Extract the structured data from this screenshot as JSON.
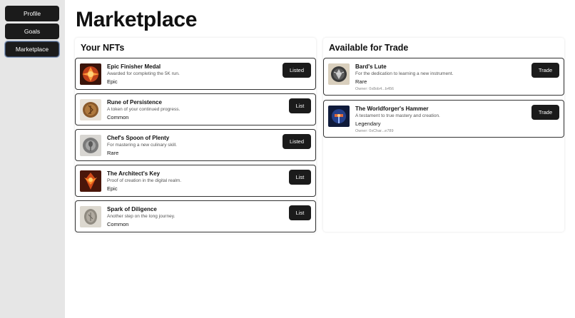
{
  "sidebar": {
    "items": [
      {
        "label": "Profile"
      },
      {
        "label": "Goals"
      },
      {
        "label": "Marketplace"
      }
    ]
  },
  "page": {
    "title": "Marketplace"
  },
  "your_nfts": {
    "heading": "Your NFTs",
    "items": [
      {
        "name": "Epic Finisher Medal",
        "description": "Awarded for completing the 5K run.",
        "rarity": "Epic",
        "action": "Listed"
      },
      {
        "name": "Rune of Persistence",
        "description": "A token of your continued progress.",
        "rarity": "Common",
        "action": "List"
      },
      {
        "name": "Chef's Spoon of Plenty",
        "description": "For mastering a new culinary skill.",
        "rarity": "Rare",
        "action": "Listed"
      },
      {
        "name": "The Architect's Key",
        "description": "Proof of creation in the digital realm.",
        "rarity": "Epic",
        "action": "List"
      },
      {
        "name": "Spark of Diligence",
        "description": "Another step on the long journey.",
        "rarity": "Common",
        "action": "List"
      }
    ]
  },
  "trade": {
    "heading": "Available for Trade",
    "items": [
      {
        "name": "Bard's Lute",
        "description": "For the dedication to learning a new instrument.",
        "rarity": "Rare",
        "owner": "Owner: 0x8ob4...b456",
        "action": "Trade"
      },
      {
        "name": "The Worldforger's Hammer",
        "description": "A testament to true mastery and creation.",
        "rarity": "Legendary",
        "owner": "Owner: 0xChar...e789",
        "action": "Trade"
      }
    ]
  },
  "colors": {
    "button_dark": "#1b1b1b",
    "sidebar_bg": "#e6e6e6",
    "active_outline": "#8fa2c0"
  },
  "icons": [
    "medal-image",
    "rune-image",
    "spoon-image",
    "key-image",
    "spark-image",
    "lute-image",
    "hammer-image"
  ]
}
